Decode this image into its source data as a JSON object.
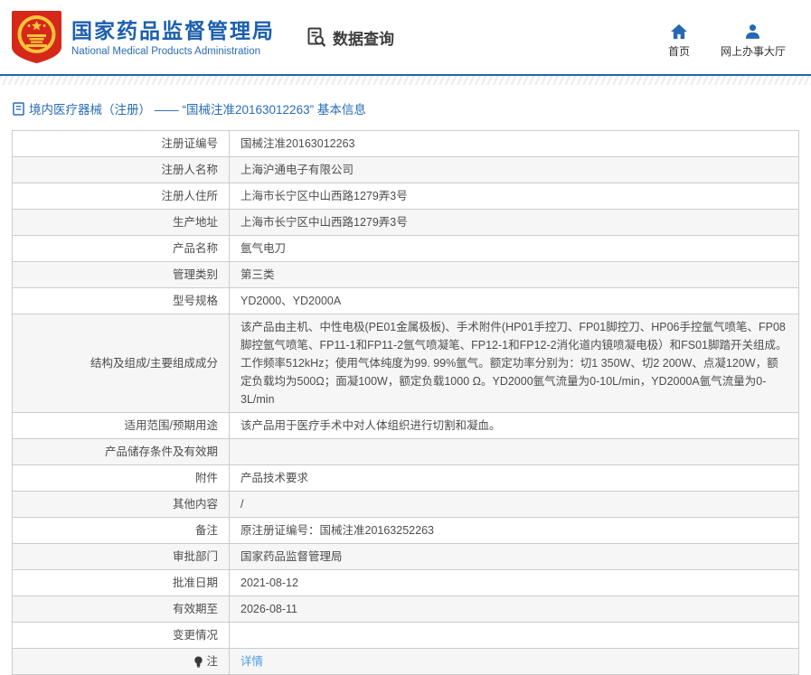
{
  "header": {
    "title": "国家药品监督管理局",
    "subtitle": "National Medical Products Administration",
    "data_query_label": "数据查询",
    "nav": [
      {
        "label": "首页",
        "icon": "home-icon"
      },
      {
        "label": "网上办事大厅",
        "icon": "user-icon"
      }
    ]
  },
  "breadcrumb": {
    "icon": "document-icon",
    "text": "境内医疗器械（注册） —— “国械注准20163012263” 基本信息"
  },
  "table": {
    "rows": [
      {
        "label": "注册证编号",
        "value": "国械注准20163012263"
      },
      {
        "label": "注册人名称",
        "value": "上海沪通电子有限公司"
      },
      {
        "label": "注册人住所",
        "value": "上海市长宁区中山西路1279弄3号"
      },
      {
        "label": "生产地址",
        "value": "上海市长宁区中山西路1279弄3号"
      },
      {
        "label": "产品名称",
        "value": "氩气电刀"
      },
      {
        "label": "管理类别",
        "value": "第三类"
      },
      {
        "label": "型号规格",
        "value": "YD2000、YD2000A"
      },
      {
        "label": "结构及组成/主要组成成分",
        "value": "该产品由主机、中性电极(PE01金属极板)、手术附件(HP01手控刀、FP01脚控刀、HP06手控氩气喷笔、FP08脚控氩气喷笔、FP11-1和FP11-2氩气喷凝笔、FP12-1和FP12-2消化道内镜喷凝电极）和FS01脚踏开关组成。工作频率512kHz；使用气体纯度为99. 99%氩气。额定功率分别为：切1 350W、切2 200W、点凝120W，额定负载均为500Ω；面凝100W，额定负载1000 Ω。YD2000氩气流量为0-10L/min，YD2000A氩气流量为0-3L/min"
      },
      {
        "label": "适用范围/预期用途",
        "value": "该产品用于医疗手术中对人体组织进行切割和凝血。"
      },
      {
        "label": "产品储存条件及有效期",
        "value": ""
      },
      {
        "label": "附件",
        "value": "产品技术要求"
      },
      {
        "label": "其他内容",
        "value": "/"
      },
      {
        "label": "备注",
        "value": "原注册证编号：国械注准20163252263"
      },
      {
        "label": "审批部门",
        "value": "国家药品监督管理局"
      },
      {
        "label": "批准日期",
        "value": "2021-08-12"
      },
      {
        "label": "有效期至",
        "value": "2026-08-11"
      },
      {
        "label": "变更情况",
        "value": ""
      },
      {
        "label": "注",
        "value": "详情",
        "icon": "bulb-icon",
        "link": true
      }
    ]
  },
  "colors": {
    "brand_blue": "#1c5fae",
    "header_rule_blue": "#2166ac",
    "breadcrumb_blue": "#2a6cb5",
    "link_blue": "#4f9be0",
    "nav_icon_blue": "#2569b3",
    "table_border": "#cccccc",
    "row_alt_bg": "#f6f6f6",
    "emblem_red": "#d5281a",
    "emblem_gold": "#f5c53a"
  }
}
